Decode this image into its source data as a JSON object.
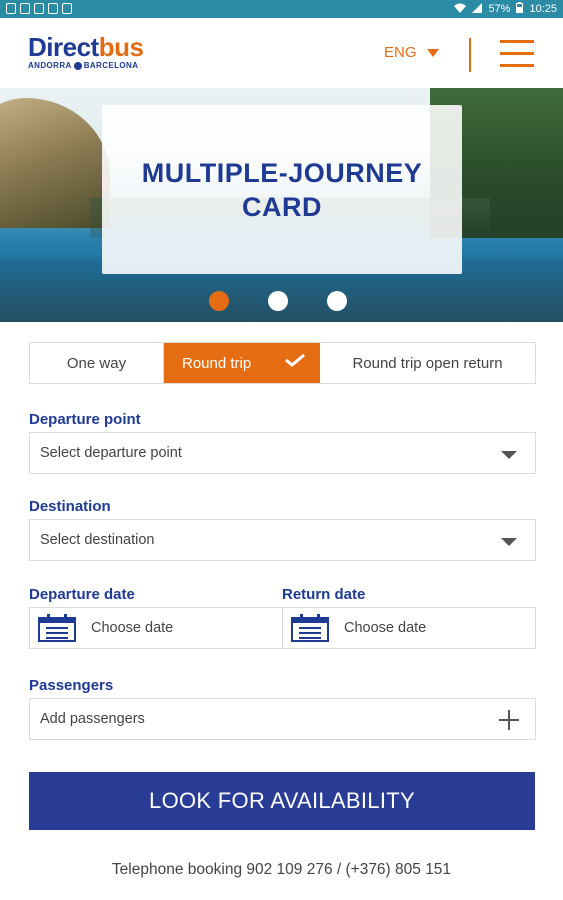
{
  "status_bar": {
    "battery": "57%",
    "time": "10:25",
    "bg_color": "#2b8aa4"
  },
  "header": {
    "logo_direct": "Direct",
    "logo_bus": "bus",
    "logo_sub_left": "ANDORRA",
    "logo_sub_right": "BARCELONA",
    "language": "ENG",
    "menu_icon": "hamburger-icon"
  },
  "hero": {
    "title": "MULTIPLE-JOURNEY CARD",
    "slides": 3,
    "active_slide": 1
  },
  "trip_tabs": [
    {
      "label": "One way",
      "selected": false
    },
    {
      "label": "Round trip",
      "selected": true
    },
    {
      "label": "Round trip open return",
      "selected": false
    }
  ],
  "form": {
    "departure_label": "Departure point",
    "departure_placeholder": "Select departure point",
    "destination_label": "Destination",
    "destination_placeholder": "Select destination",
    "departure_date_label": "Departure date",
    "departure_date_value": "Choose date",
    "return_date_label": "Return date",
    "return_date_value": "Choose date",
    "passengers_label": "Passengers",
    "passengers_placeholder": "Add passengers"
  },
  "cta_label": "LOOK FOR AVAILABILITY",
  "telephone_text": "Telephone booking 902 109 276 / (+376) 805 151",
  "colors": {
    "brand_blue": "#1f3a93",
    "brand_orange": "#e46c12",
    "cta_blue": "#2a3d96"
  }
}
